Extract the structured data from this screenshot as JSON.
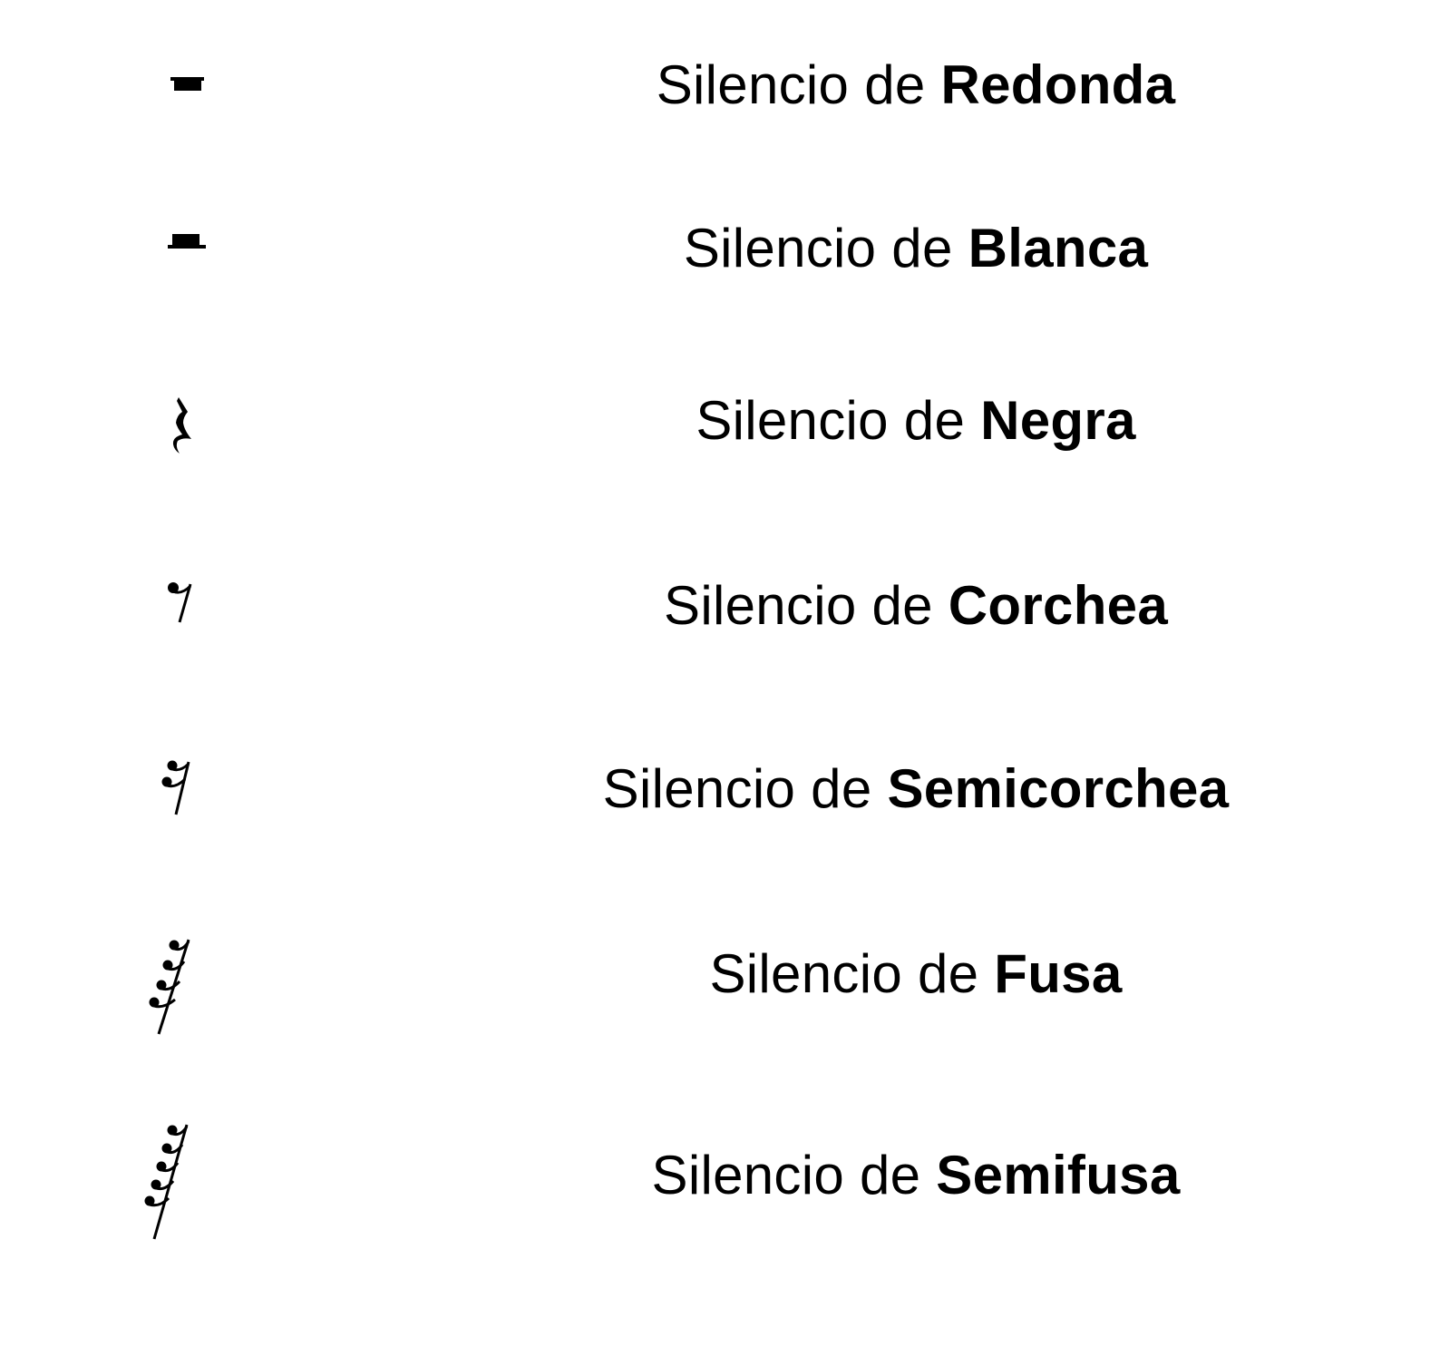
{
  "rests": [
    {
      "prefix": "Silencio de ",
      "name": "Redonda",
      "symbol": "whole-rest"
    },
    {
      "prefix": "Silencio de ",
      "name": "Blanca",
      "symbol": "half-rest"
    },
    {
      "prefix": "Silencio de ",
      "name": "Negra",
      "symbol": "quarter-rest"
    },
    {
      "prefix": "Silencio de ",
      "name": "Corchea",
      "symbol": "eighth-rest"
    },
    {
      "prefix": "Silencio de ",
      "name": "Semicorchea",
      "symbol": "sixteenth-rest"
    },
    {
      "prefix": "Silencio de ",
      "name": "Fusa",
      "symbol": "thirty-second-rest"
    },
    {
      "prefix": "Silencio de ",
      "name": "Semifusa",
      "symbol": "sixty-fourth-rest"
    }
  ]
}
